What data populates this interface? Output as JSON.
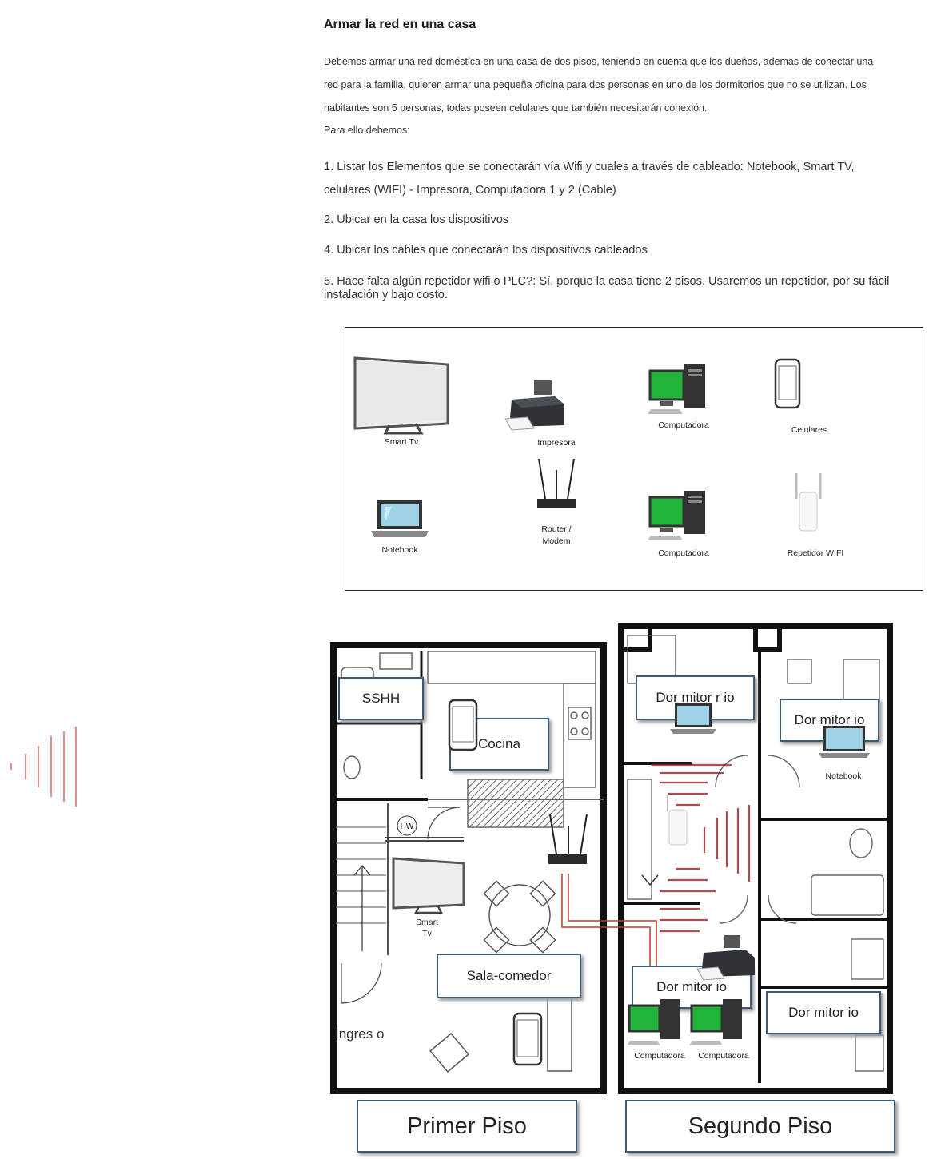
{
  "doc": {
    "title": "Armar la red en una casa",
    "intro_lines": [
      "Debemos armar una red doméstica en una casa de dos pisos, teniendo en cuenta que los dueños, ademas de conectar una",
      "red para la familia, quieren armar una pequeña oficina para dos personas en uno de los dormitorios que no se utilizan. Los",
      "habitantes son 5 personas, todas poseen celulares que también necesitarán conexión.",
      "Para ello debemos:"
    ],
    "step1_line1": "1. Listar los Elementos que se conectarán vía Wifi y cuales a través de cableado: Notebook, Smart TV,",
    "step1_line2": "celulares (WIFI) - Impresora, Computadora 1 y 2 (Cable)",
    "step2": "2. Ubicar en la casa los dispositivos",
    "step4": "4. Ubicar los cables que conectarán los dispositivos cableados",
    "step5": "5. Hace falta algún repetidor wifi o PLC?: Sí, porque la casa tiene 2 pisos. Usaremos un repetidor, por su fácil instalación y bajo costo."
  },
  "legend": {
    "smart_tv": "Smart Tv",
    "impresora": "Impresora",
    "computadora_1": "Computadora",
    "celulares": "Celulares",
    "notebook": "Notebook",
    "router_line1": "Router /",
    "router_line2": "Modem",
    "computadora_2": "Computadora",
    "repetidor": "Repetidor WIFI"
  },
  "plan": {
    "sshh": "SSHH",
    "cocina": "Cocina",
    "sala": "Sala-comedor",
    "ingreso": "Ingres o",
    "hw": "HW",
    "smart_tv_line1": "Smart",
    "smart_tv_line2": "Tv",
    "dorm_1": "Dor mitor r io",
    "dorm_2": "Dor mitor io",
    "dorm_3": "Dor mitor io",
    "dorm_4": "Dor mitor io",
    "notebook": "Notebook",
    "computadora_a": "Computadora",
    "computadora_b": "Computadora",
    "primer_piso": "Primer Piso",
    "segundo_piso": "Segundo Piso"
  },
  "colors": {
    "screen_green": "#22b33a",
    "cable_red": "#c0392b",
    "label_border": "#3a5a7a"
  }
}
